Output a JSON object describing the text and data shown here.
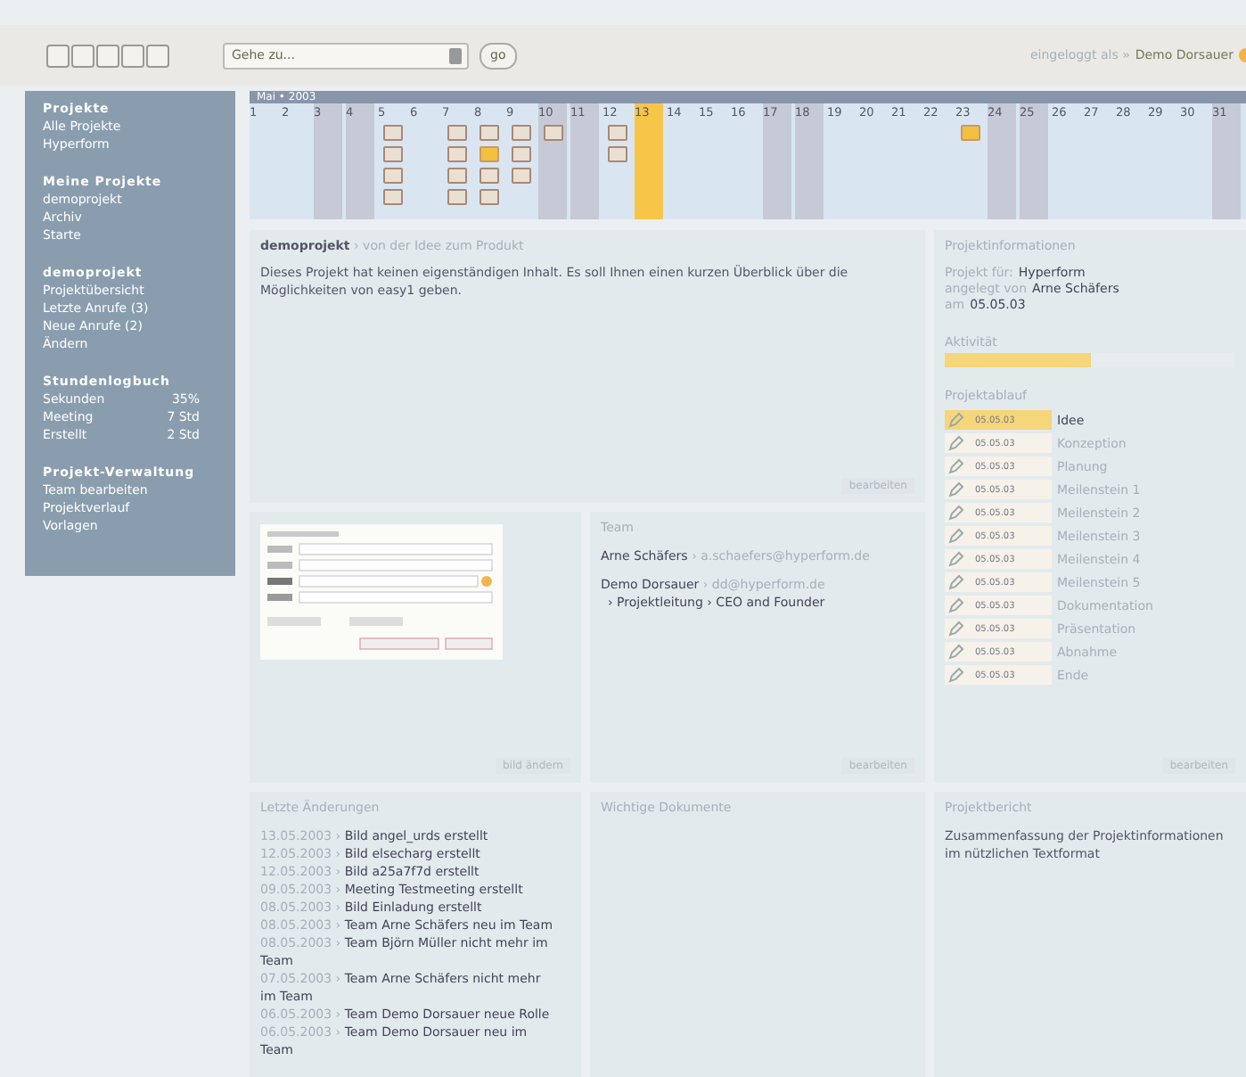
{
  "header": {
    "goto": {
      "value": "Gehe zu...",
      "button": "go"
    },
    "login_label": "eingeloggt als »",
    "user": "Demo Dorsauer"
  },
  "sidebar": [
    {
      "title": "Projekte",
      "items": [
        {
          "label": "Alle Projekte"
        },
        {
          "label": "Hyperform"
        }
      ]
    },
    {
      "title": "Meine Projekte",
      "items": [
        {
          "label": "demoprojekt"
        },
        {
          "label": "Archiv"
        },
        {
          "label": "Starte"
        }
      ]
    },
    {
      "title": "demoprojekt",
      "items": [
        {
          "label": "Projektübersicht"
        },
        {
          "label": "Letzte Anrufe (3)"
        },
        {
          "label": "Neue Anrufe (2)"
        },
        {
          "label": "Ändern"
        }
      ]
    },
    {
      "title": "Stundenlogbuch",
      "items": [
        {
          "label": "Sekunden",
          "value": "35%"
        },
        {
          "label": "Meeting",
          "value": "7 Std"
        },
        {
          "label": "Erstellt",
          "value": "2 Std"
        }
      ]
    },
    {
      "title": "Projekt-Verwaltung",
      "items": [
        {
          "label": "Team bearbeiten"
        },
        {
          "label": "Projektverlauf"
        },
        {
          "label": "Vorlagen"
        }
      ]
    }
  ],
  "calendar": {
    "title": "Mai • 2003",
    "days": [
      {
        "label": "1",
        "weekend": false,
        "today": false
      },
      {
        "label": "2",
        "weekend": false,
        "today": false
      },
      {
        "label": "3",
        "weekend": true,
        "today": false
      },
      {
        "label": "4",
        "weekend": true,
        "today": false
      },
      {
        "label": "5",
        "weekend": false,
        "today": false,
        "events": [
          {
            "highlighted": false
          },
          {
            "highlighted": false
          },
          {
            "highlighted": false
          },
          {
            "highlighted": false
          }
        ]
      },
      {
        "label": "6",
        "weekend": false,
        "today": false
      },
      {
        "label": "7",
        "weekend": false,
        "today": false,
        "events": [
          {
            "highlighted": false
          },
          {
            "highlighted": false
          },
          {
            "highlighted": false
          },
          {
            "highlighted": false
          }
        ]
      },
      {
        "label": "8",
        "weekend": false,
        "today": false,
        "events": [
          {
            "highlighted": false
          },
          {
            "highlighted": true
          },
          {
            "highlighted": false
          },
          {
            "highlighted": false
          }
        ]
      },
      {
        "label": "9",
        "weekend": false,
        "today": false,
        "events": [
          {
            "highlighted": false
          },
          {
            "highlighted": false
          },
          {
            "highlighted": false
          }
        ]
      },
      {
        "label": "10",
        "weekend": true,
        "today": false,
        "events": [
          {
            "highlighted": false
          }
        ]
      },
      {
        "label": "11",
        "weekend": true,
        "today": false
      },
      {
        "label": "12",
        "weekend": false,
        "today": false,
        "events": [
          {
            "highlighted": false
          },
          {
            "highlighted": false
          }
        ]
      },
      {
        "label": "13",
        "weekend": false,
        "today": true
      },
      {
        "label": "14",
        "weekend": false,
        "today": false
      },
      {
        "label": "15",
        "weekend": false,
        "today": false
      },
      {
        "label": "16",
        "weekend": false,
        "today": false
      },
      {
        "label": "17",
        "weekend": true,
        "today": false
      },
      {
        "label": "18",
        "weekend": true,
        "today": false
      },
      {
        "label": "19",
        "weekend": false,
        "today": false
      },
      {
        "label": "20",
        "weekend": false,
        "today": false
      },
      {
        "label": "21",
        "weekend": false,
        "today": false
      },
      {
        "label": "22",
        "weekend": false,
        "today": false
      },
      {
        "label": "23",
        "weekend": false,
        "today": false,
        "events": [
          {
            "highlighted": true
          }
        ]
      },
      {
        "label": "24",
        "weekend": true,
        "today": false
      },
      {
        "label": "25",
        "weekend": true,
        "today": false
      },
      {
        "label": "26",
        "weekend": false,
        "today": false
      },
      {
        "label": "27",
        "weekend": false,
        "today": false
      },
      {
        "label": "28",
        "weekend": false,
        "today": false
      },
      {
        "label": "29",
        "weekend": false,
        "today": false
      },
      {
        "label": "30",
        "weekend": false,
        "today": false
      },
      {
        "label": "31",
        "weekend": true,
        "today": false
      }
    ]
  },
  "overview": {
    "title": "demoprojekt",
    "subtitle": "› von der Idee zum Produkt",
    "text": "Dieses Projekt hat keinen eigenständigen Inhalt. Es soll Ihnen einen kurzen Überblick über die Möglichkeiten von easy1 geben.",
    "link": "bearbeiten"
  },
  "image_panel": {
    "link": "bild ändern"
  },
  "team": {
    "title": "Team",
    "members": [
      {
        "name": "Arne Schäfers",
        "email": "› a.schaefers@hyperform.de"
      },
      {
        "name": "Demo Dorsauer",
        "email": "› dd@hyperform.de",
        "role": "› Projektleitung › CEO and Founder"
      }
    ],
    "link": "bearbeiten"
  },
  "info": {
    "title": "Projektinformationen",
    "lines": [
      {
        "label": "Projekt für:",
        "value": "Hyperform"
      },
      {
        "label": "angelegt von",
        "value": "Arne Schäfers"
      },
      {
        "label": "am",
        "value": "05.05.03"
      }
    ],
    "activity": {
      "label": "Aktivität",
      "level": 0.5
    },
    "phases_title": "Projektablauf",
    "phases": [
      {
        "date": "05.05.03",
        "name": "Idee",
        "selected": true
      },
      {
        "date": "05.05.03",
        "name": "Konzeption",
        "selected": false
      },
      {
        "date": "05.05.03",
        "name": "Planung",
        "selected": false
      },
      {
        "date": "05.05.03",
        "name": "Meilenstein 1",
        "selected": false
      },
      {
        "date": "05.05.03",
        "name": "Meilenstein 2",
        "selected": false
      },
      {
        "date": "05.05.03",
        "name": "Meilenstein 3",
        "selected": false
      },
      {
        "date": "05.05.03",
        "name": "Meilenstein 4",
        "selected": false
      },
      {
        "date": "05.05.03",
        "name": "Meilenstein 5",
        "selected": false
      },
      {
        "date": "05.05.03",
        "name": "Dokumentation",
        "selected": false
      },
      {
        "date": "05.05.03",
        "name": "Präsentation",
        "selected": false
      },
      {
        "date": "05.05.03",
        "name": "Abnahme",
        "selected": false
      },
      {
        "date": "05.05.03",
        "name": "Ende",
        "selected": false
      }
    ],
    "link": "bearbeiten"
  },
  "changes": {
    "title": "Letzte Änderungen",
    "items": [
      {
        "date": "13.05.2003 ›",
        "text": "Bild angel_urds erstellt"
      },
      {
        "date": "12.05.2003 ›",
        "text": "Bild elsecharg erstellt"
      },
      {
        "date": "12.05.2003 ›",
        "text": "Bild a25a7f7d erstellt"
      },
      {
        "date": "09.05.2003 ›",
        "text": "Meeting Testmeeting erstellt"
      },
      {
        "date": "08.05.2003 ›",
        "text": "Bild Einladung erstellt"
      },
      {
        "date": "08.05.2003 ›",
        "text": "Team Arne Schäfers neu im Team"
      },
      {
        "date": "08.05.2003 ›",
        "text": "Team Björn Müller nicht mehr im Team"
      },
      {
        "date": "07.05.2003 ›",
        "text": "Team Arne Schäfers nicht mehr im Team"
      },
      {
        "date": "06.05.2003 ›",
        "text": "Team Demo Dorsauer neue Rolle"
      },
      {
        "date": "06.05.2003 ›",
        "text": "Team Demo Dorsauer neu im Team"
      }
    ]
  },
  "documents": {
    "title": "Wichtige Dokumente"
  },
  "report": {
    "title": "Projektbericht",
    "text": "Zusammenfassung der Projektinformationen im nützlichen Textformat"
  }
}
